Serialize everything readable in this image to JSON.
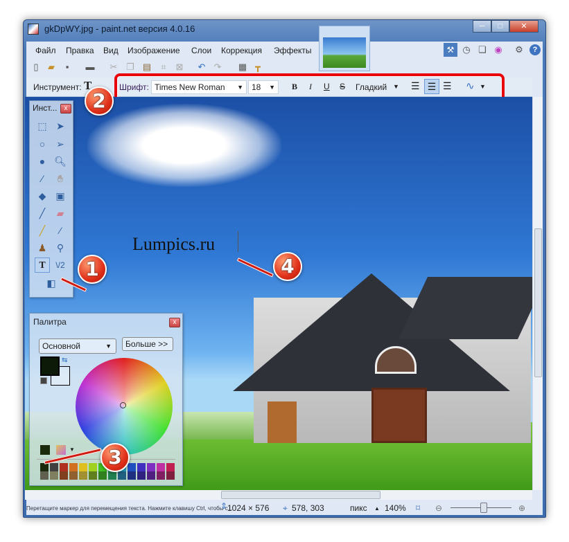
{
  "window": {
    "title": "gkDpWY.jpg - paint.net версия 4.0.16",
    "controls": [
      "minimize",
      "maximize",
      "close"
    ]
  },
  "menu": [
    "Файл",
    "Правка",
    "Вид",
    "Изображение",
    "Слои",
    "Коррекция",
    "Эффекты"
  ],
  "toolbar": {
    "icons": [
      "new-icon",
      "open-icon",
      "save-icon",
      "print-icon",
      "cut-icon",
      "copy-icon",
      "paste-icon",
      "crop-icon",
      "deselect-icon",
      "undo-icon",
      "redo-icon",
      "grid-icon",
      "ruler-icon"
    ]
  },
  "right_buttons": [
    "tools-icon",
    "history-icon",
    "layers-icon",
    "colors-icon",
    "settings-icon",
    "help-icon"
  ],
  "tool_options": {
    "tool_label": "Инструмент:",
    "font_label": "Шрифт:",
    "font": "Times New Roman",
    "size": "18",
    "bold": "B",
    "italic": "I",
    "underline": "U",
    "strike": "S",
    "antialias": "Гладкий",
    "align": [
      "left",
      "center",
      "right"
    ],
    "align_selected": "center"
  },
  "tools_panel": {
    "title": "Инст...",
    "selected": "text"
  },
  "palette": {
    "title": "Палитра",
    "mode": "Основной",
    "more": "Больше >>",
    "primary_color": "#0d1a07",
    "secondary_color": "#ffffff",
    "swatches_top": [
      "#1a2a0a",
      "#404040",
      "#b03020",
      "#d07020",
      "#e0c020",
      "#a0d020",
      "#40c020",
      "#20c080",
      "#20a0c0",
      "#2050c0",
      "#4030c0",
      "#8030c0",
      "#c030a0",
      "#c02050"
    ],
    "swatches_bottom": [
      "#606050",
      "#808060",
      "#804020",
      "#906030",
      "#a09030",
      "#608020",
      "#308020",
      "#208050",
      "#206080",
      "#203080",
      "#302080",
      "#502080",
      "#802060",
      "#802040"
    ]
  },
  "canvas": {
    "text": "Lumpics.ru"
  },
  "callouts": [
    "1",
    "2",
    "3",
    "4"
  ],
  "status": {
    "hint": "Перетащите маркер для перемещения текста. Нажмите клавишу Ctrl, чтобы с...",
    "size": "1024 × 576",
    "cursor": "578, 303",
    "units": "пикс",
    "zoom": "140%",
    "zoom_slider": 0.5
  },
  "colors": {
    "accent": "#e0301a",
    "frame": "#4b79b8"
  }
}
